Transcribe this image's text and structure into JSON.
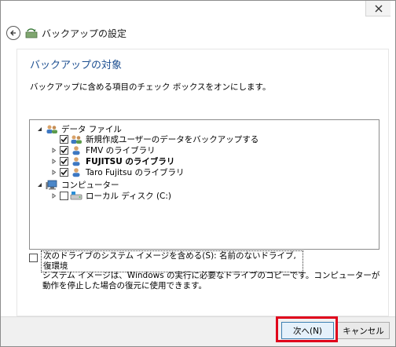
{
  "window": {
    "title": "バックアップの設定",
    "close_icon": "close-icon",
    "back_icon": "back-arrow-icon",
    "app_icon": "backup-app-icon"
  },
  "main": {
    "section_title": "バックアップの対象",
    "instruction": "バックアップに含める項目のチェック ボックスをオンにします。"
  },
  "tree": {
    "data_files": {
      "label": "データ ファイル",
      "items": [
        {
          "label": "新規作成ユーザーのデータをバックアップする",
          "checked": true,
          "bold": false
        },
        {
          "label": "FMV のライブラリ",
          "checked": true,
          "bold": false
        },
        {
          "label": "FUJITSU のライブラリ",
          "checked": true,
          "bold": true
        },
        {
          "label": "Taro  Fujitsu のライブラリ",
          "checked": true,
          "bold": false
        }
      ]
    },
    "computer": {
      "label": "コンピューター",
      "items": [
        {
          "label": "ローカル ディスク (C:)",
          "checked": false,
          "bold": false
        }
      ]
    }
  },
  "system_image": {
    "label_line1": "次のドライブのシステム イメージを含める(S): 名前のないドライブ, (C:), Windows 回",
    "label_line2": "復環境",
    "description": "システム イメージは、Windows の実行に必要なドライブのコピーです。コンピューターが動作を停止した場合の復元に使用できます。",
    "checked": false
  },
  "buttons": {
    "next": "次へ(N)",
    "cancel": "キャンセル"
  },
  "colors": {
    "accent_title": "#1d4f91",
    "highlight": "#e0001b"
  }
}
